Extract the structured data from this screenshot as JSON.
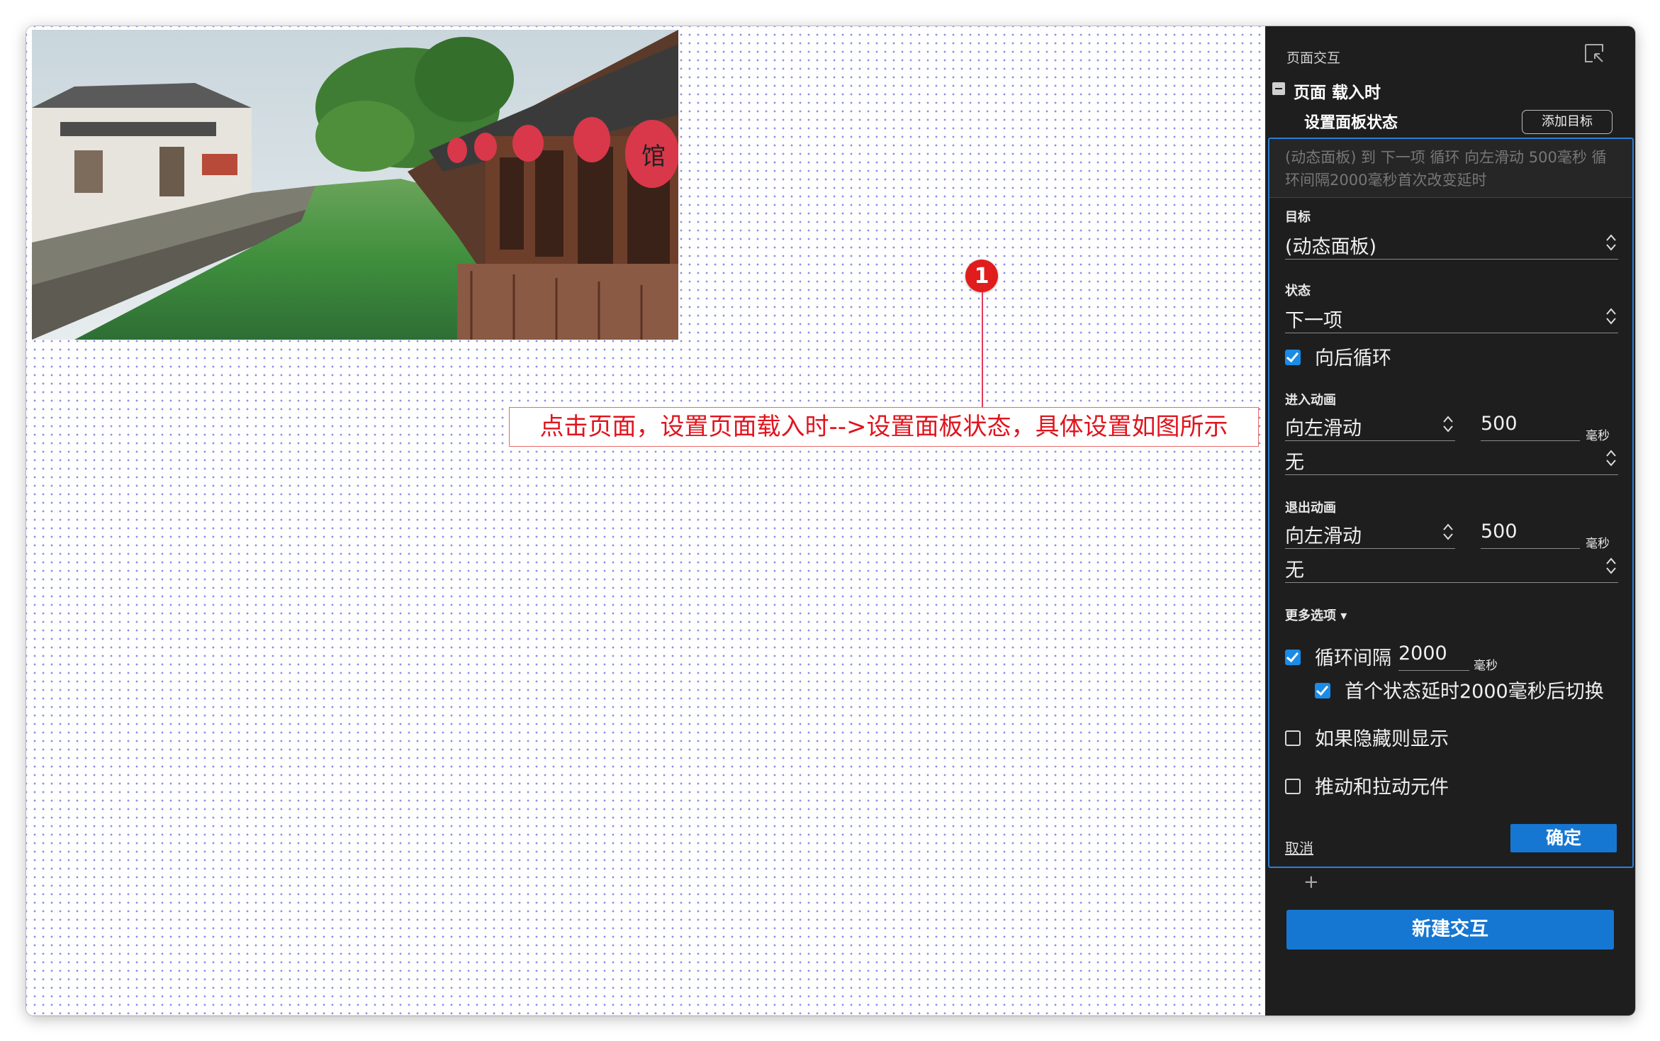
{
  "annotation": {
    "marker_number": "1",
    "text": "点击页面，设置页面载入时-->设置面板状态，具体设置如图所示"
  },
  "panel": {
    "title": "页面交互",
    "event_label": "页面 载入时",
    "action_label": "设置面板状态",
    "add_target_label": "添加目标",
    "summary": "(动态面板) 到 下一项 循环 向左滑动 500毫秒 循环间隔2000毫秒首次改变延时",
    "target": {
      "label": "目标",
      "value": "(动态面板)"
    },
    "state": {
      "label": "状态",
      "value": "下一项"
    },
    "wrap": {
      "label": "向后循环",
      "checked": true
    },
    "enter_animation": {
      "label": "进入动画",
      "type": "向左滑动",
      "duration": "500",
      "unit": "毫秒",
      "easing": "无"
    },
    "exit_animation": {
      "label": "退出动画",
      "type": "向左滑动",
      "duration": "500",
      "unit": "毫秒",
      "easing": "无"
    },
    "more_options_label": "更多选项 ▾",
    "repeat": {
      "label": "循环间隔",
      "value": "2000",
      "unit": "毫秒",
      "checked": true
    },
    "first_delay": {
      "label": "首个状态延时2000毫秒后切换",
      "checked": true
    },
    "show_if_hidden": {
      "label": "如果隐藏则显示",
      "checked": false
    },
    "push_pull": {
      "label": "推动和拉动元件",
      "checked": false
    },
    "cancel_label": "取消",
    "ok_label": "确定",
    "plus_label": "+",
    "new_interaction_label": "新建交互"
  },
  "colors": {
    "panel_bg": "#1e1e1e",
    "accent_blue": "#1677d3",
    "annotation_red": "#e0141e",
    "grid_dot": "#8b8de8"
  }
}
